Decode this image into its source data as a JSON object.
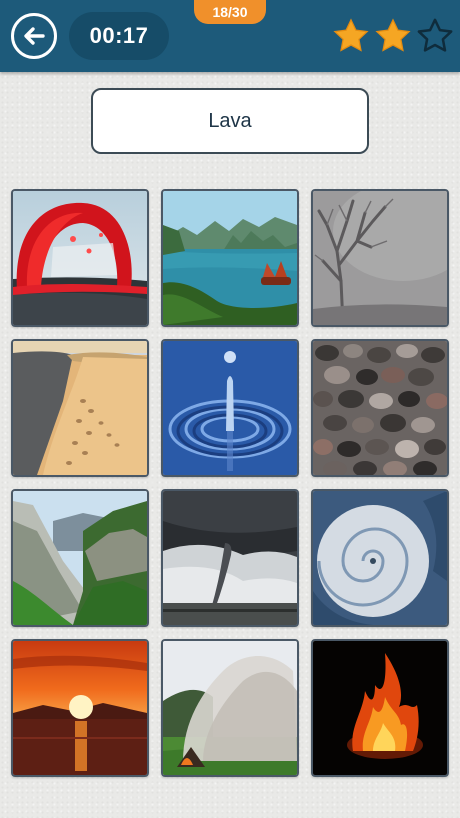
{
  "header": {
    "back_icon": "back-arrow-icon",
    "timer": "00:17",
    "progress": "18/30",
    "stars_earned": 2,
    "stars_total": 3,
    "colors": {
      "bar": "#1d5a7a",
      "timer_bg": "#164c68",
      "badge": "#f0902b",
      "star": "#f5a623"
    }
  },
  "prompt": {
    "word": "Lava"
  },
  "grid": {
    "tiles": [
      {
        "name": "lava-tile"
      },
      {
        "name": "bay-tile"
      },
      {
        "name": "fog-tile"
      },
      {
        "name": "sand-dune-tile"
      },
      {
        "name": "water-drop-tile"
      },
      {
        "name": "pebbles-tile"
      },
      {
        "name": "valley-tile"
      },
      {
        "name": "tornado-tile"
      },
      {
        "name": "hurricane-tile"
      },
      {
        "name": "sunset-tile"
      },
      {
        "name": "smoke-tile"
      },
      {
        "name": "fire-tile"
      }
    ]
  }
}
